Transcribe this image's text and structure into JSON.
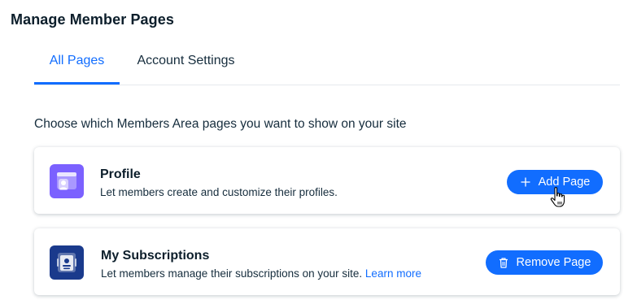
{
  "page_title": "Manage Member Pages",
  "tabs": [
    {
      "label": "All Pages",
      "active": true
    },
    {
      "label": "Account Settings",
      "active": false
    }
  ],
  "description": "Choose which Members Area pages you want to show on your site",
  "cards": [
    {
      "title": "Profile",
      "subtitle": "Let members create and customize their profiles.",
      "icon": "profile-page-icon",
      "button_label": "Add Page",
      "button_icon": "plus-icon"
    },
    {
      "title": "My Subscriptions",
      "subtitle": "Let members manage their subscriptions on your site.",
      "link_label": "Learn more",
      "icon": "subscriptions-page-icon",
      "button_label": "Remove Page",
      "button_icon": "trash-icon"
    }
  ],
  "colors": {
    "accent": "#116dff",
    "profile_icon_bg": "#7b61ff",
    "subscriptions_icon_bg": "#1a3a8c",
    "text": "#162d3d"
  }
}
